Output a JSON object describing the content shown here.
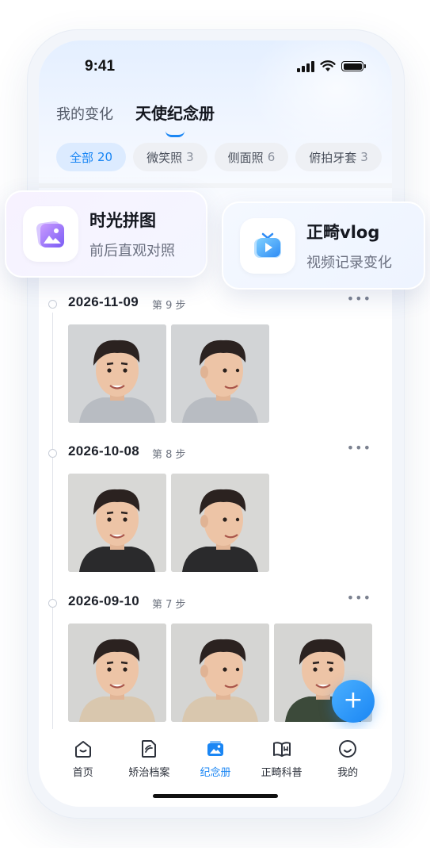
{
  "status": {
    "time": "9:41"
  },
  "top_tabs": [
    {
      "label": "我的变化",
      "active": false
    },
    {
      "label": "天使纪念册",
      "active": true
    }
  ],
  "chips": [
    {
      "label": "全部",
      "count": "20",
      "active": true
    },
    {
      "label": "微笑照",
      "count": "3",
      "active": false
    },
    {
      "label": "侧面照",
      "count": "6",
      "active": false
    },
    {
      "label": "俯拍牙套",
      "count": "3",
      "active": false
    }
  ],
  "feature_cards": [
    {
      "title": "时光拼图",
      "subtitle": "前后直观对照"
    },
    {
      "title": "正畸vlog",
      "subtitle": "视频记录变化"
    }
  ],
  "entries": [
    {
      "date": "2026-11-09",
      "step": "第 9 步",
      "more": "•••"
    },
    {
      "date": "2026-10-08",
      "step": "第 8 步",
      "more": "•••"
    },
    {
      "date": "2026-09-10",
      "step": "第 7 步",
      "more": "•••"
    }
  ],
  "fab": {
    "symbol": "+"
  },
  "bottom_nav": [
    {
      "label": "首页",
      "icon": "home-icon"
    },
    {
      "label": "矫治档案",
      "icon": "file-icon"
    },
    {
      "label": "纪念册",
      "icon": "album-icon",
      "active": true
    },
    {
      "label": "正畸科普",
      "icon": "book-icon"
    },
    {
      "label": "我的",
      "icon": "profile-icon"
    }
  ],
  "colors": {
    "accent": "#1a86f4",
    "chip_active_bg": "#dcebff"
  }
}
